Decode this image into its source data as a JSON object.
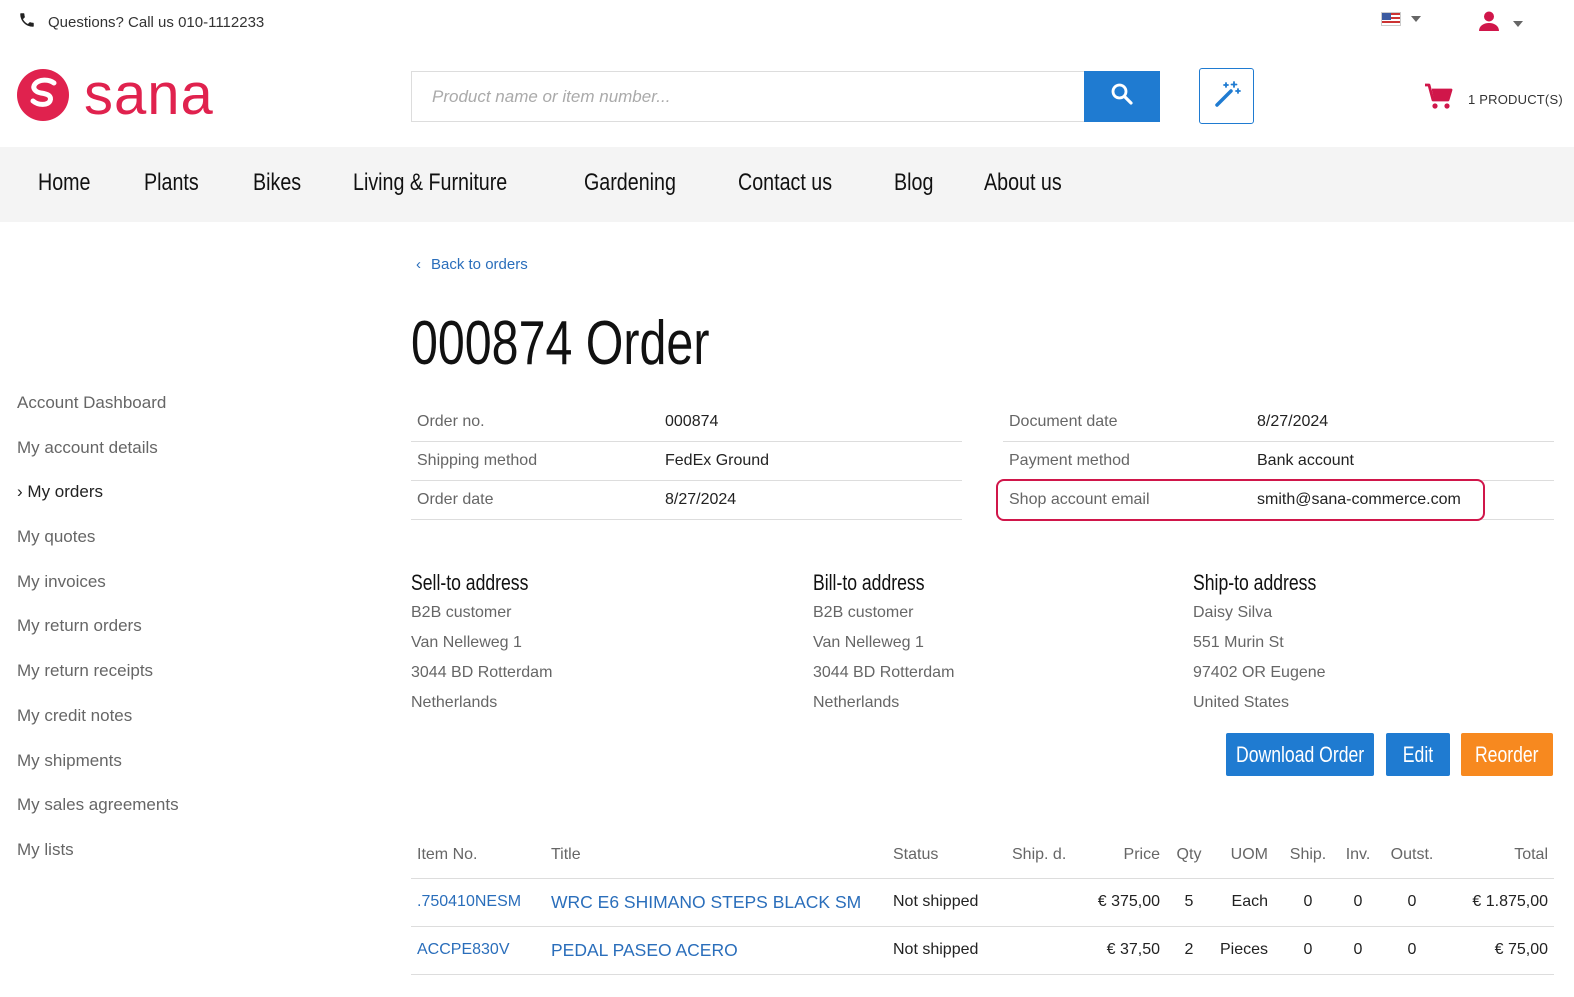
{
  "topbar": {
    "phone_text": "Questions? Call us 010-1112233"
  },
  "header": {
    "logo_text": "sana",
    "search_placeholder": "Product name or item number...",
    "cart_label": "1 PRODUCT(S)"
  },
  "nav": {
    "items": [
      "Home",
      "Plants",
      "Bikes",
      "Living & Furniture",
      "Gardening",
      "Contact us",
      "Blog",
      "About us"
    ]
  },
  "sidebar": {
    "items": [
      {
        "label": "Account Dashboard"
      },
      {
        "label": "My account details"
      },
      {
        "label": "My orders",
        "prefix": "›"
      },
      {
        "label": "My quotes"
      },
      {
        "label": "My invoices"
      },
      {
        "label": "My return orders"
      },
      {
        "label": "My return receipts"
      },
      {
        "label": "My credit notes"
      },
      {
        "label": "My shipments"
      },
      {
        "label": "My sales agreements"
      },
      {
        "label": "My lists"
      }
    ]
  },
  "main": {
    "back_label": "Back to orders",
    "title": "000874 Order",
    "info_left": [
      {
        "label": "Order no.",
        "value": "000874"
      },
      {
        "label": "Shipping method",
        "value": "FedEx Ground"
      },
      {
        "label": "Order date",
        "value": "8/27/2024"
      }
    ],
    "info_right": [
      {
        "label": "Document date",
        "value": "8/27/2024"
      },
      {
        "label": "Payment method",
        "value": "Bank account"
      },
      {
        "label": "Shop account email",
        "value": "smith@sana-commerce.com"
      }
    ],
    "sell_to": {
      "title": "Sell-to address",
      "lines": [
        "B2B customer",
        "Van Nelleweg 1",
        "3044 BD Rotterdam",
        "Netherlands"
      ]
    },
    "bill_to": {
      "title": "Bill-to address",
      "lines": [
        "B2B customer",
        "Van Nelleweg 1",
        "3044 BD Rotterdam",
        "Netherlands"
      ]
    },
    "ship_to": {
      "title": "Ship-to address",
      "lines": [
        "Daisy Silva",
        "551 Murin St",
        "97402 OR Eugene",
        "United States"
      ]
    },
    "buttons": {
      "download": "Download Order",
      "edit": "Edit",
      "reorder": "Reorder"
    },
    "highlight_color": "#d0164a",
    "accent_color": "#1f7bd1",
    "reorder_color": "#f7891f"
  },
  "lines": {
    "headers": [
      "Item No.",
      "Title",
      "Status",
      "Ship. d.",
      "Price",
      "Qty",
      "UOM",
      "Ship.",
      "Inv.",
      "Outst.",
      "Total"
    ],
    "rows": [
      {
        "item_no": ".750410NESM",
        "title": "WRC E6 SHIMANO STEPS BLACK SM",
        "status": "Not shipped",
        "ship_date": "",
        "price": "€ 375,00",
        "qty": "5",
        "uom": "Each",
        "ship": "0",
        "inv": "0",
        "outst": "0",
        "total": "€ 1.875,00"
      },
      {
        "item_no": "ACCPE830V",
        "title": "PEDAL PASEO ACERO",
        "status": "Not shipped",
        "ship_date": "",
        "price": "€ 37,50",
        "qty": "2",
        "uom": "Pieces",
        "ship": "0",
        "inv": "0",
        "outst": "0",
        "total": "€ 75,00"
      }
    ]
  }
}
